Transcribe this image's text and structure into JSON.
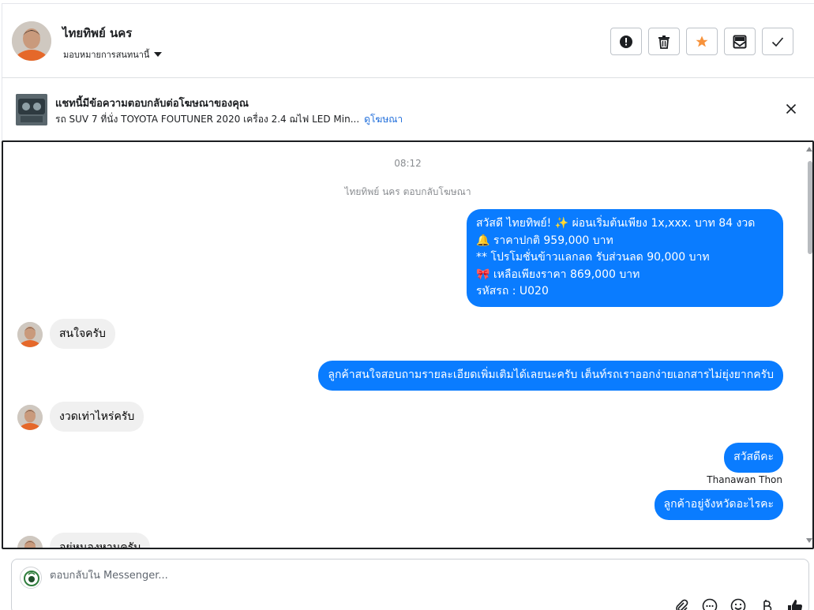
{
  "header": {
    "contact_name": "ไทยทิพย์ นคร",
    "assign_label": "มอบหมายการสนทนานี้",
    "actions": [
      "mark-spam",
      "delete",
      "star",
      "mark-unread",
      "done"
    ]
  },
  "ad": {
    "title": "แชทนี้มีข้อความตอบกลับต่อโฆษณาของคุณ",
    "subtitle": "รถ SUV 7 ที่นั่ง TOYOTA FOUTUNER 2020 เครื่อง 2.4 ฌไฟ LED Min...",
    "link": "ดูโฆษณา"
  },
  "chat": {
    "timestamp": "08:12",
    "system_note": "ไทยทิพย์ นคร ตอบกลับโฆษณา",
    "msg1": {
      "line1": "สวัสดี ไทยทิพย์! ✨  ผ่อนเริ่มต้นเพียง 1x,xxx. บาท 84 งวด",
      "line2": "🔔 ราคาปกติ 959,000 บาท",
      "line3": "** โปรโมชั่นข้าวแลกลด รับส่วนลด 90,000 บาท",
      "line4": "🎀  เหลือเพียงราคา 869,000 บาท",
      "line5": " รหัสรถ : U020"
    },
    "msg2": "สนใจครับ",
    "msg3": "ลูกค้าสนใจสอบถามรายละเอียดเพิ่มเติมได้เลยนะครับ เต็นท์รถเราออกง่ายเอกสารไม่ยุ่งยากครับ",
    "msg4": "งวดเท่าไหร่ครับ",
    "msg5": "สวัสดีคะ",
    "sender": "Thanawan Thon",
    "msg6": "ลูกค้าอยู่จังหวัดอะไรคะ",
    "msg7": "อยู่หนองหานครับ"
  },
  "composer": {
    "placeholder": "ตอบกลับใน Messenger...",
    "tools": [
      "attachment",
      "saved-reply",
      "emoji",
      "currency-baht",
      "like"
    ]
  },
  "colors": {
    "outgoing_bubble": "#0a7cff",
    "incoming_bubble": "#f0f0f0",
    "star": "#f7923b",
    "link": "#216fdb"
  }
}
